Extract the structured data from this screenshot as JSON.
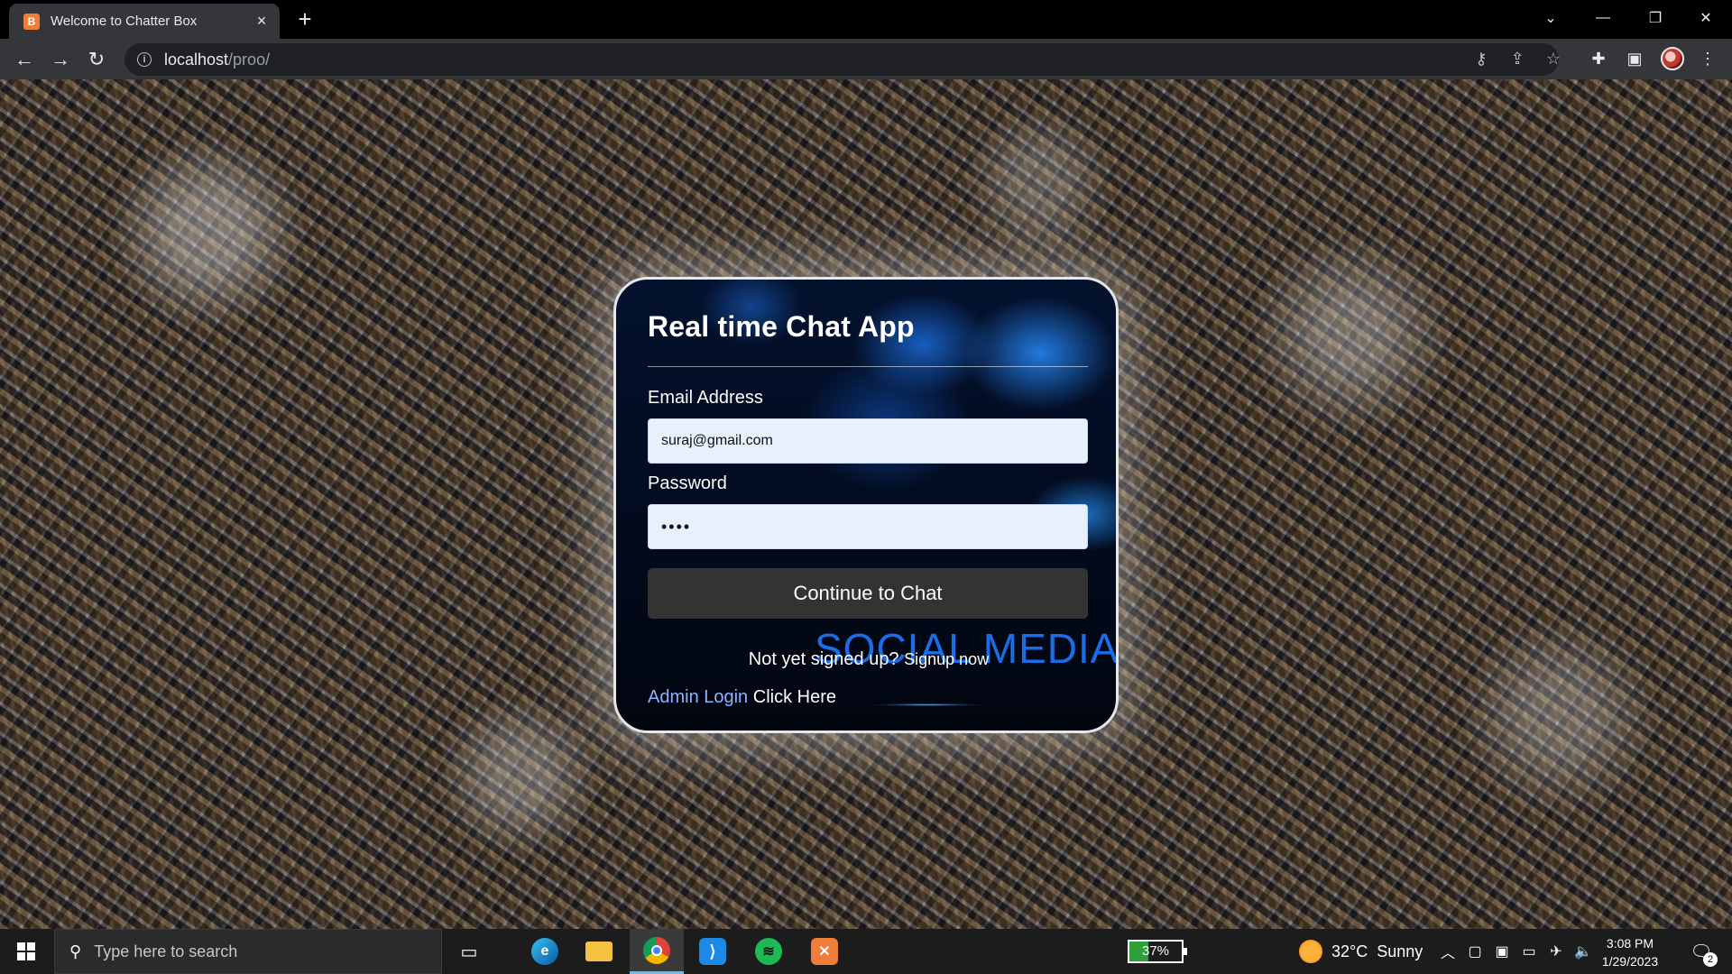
{
  "browser": {
    "tab_title": "Welcome to Chatter Box",
    "tab_favicon_letter": "B",
    "new_tab_symbol": "+",
    "url_host": "localhost",
    "url_path": "/proo/",
    "tab_close_symbol": "×"
  },
  "login": {
    "title": "Real time Chat App",
    "email_label": "Email Address",
    "email_value": "suraj@gmail.com",
    "password_label": "Password",
    "password_value": "••••",
    "submit_label": "Continue to Chat",
    "background_text": "SOCIAL MEDIA",
    "signup_prompt": "Not yet signed up?",
    "signup_link": "Signup now",
    "admin_link": "Admin Login",
    "admin_suffix": "Click Here"
  },
  "taskbar": {
    "search_placeholder": "Type here to search",
    "battery_percent": "37%",
    "battery_level": 0.37,
    "weather_temp": "32°C",
    "weather_desc": "Sunny",
    "time": "3:08 PM",
    "date": "1/29/2023",
    "notification_count": "2"
  },
  "colors": {
    "accent_link": "#8ab4ff",
    "button_bg": "#333333",
    "watermark": "#1f78ff",
    "battery_fill": "#2e9d3a"
  },
  "icons": [
    "tab-close-icon",
    "new-tab-icon",
    "back-icon",
    "forward-icon",
    "reload-icon",
    "site-info-icon",
    "key-icon",
    "share-icon",
    "star-icon",
    "extensions-icon",
    "side-panel-icon",
    "menu-icon",
    "windows-start-icon",
    "search-icon",
    "task-view-icon",
    "edge-icon",
    "file-explorer-icon",
    "chrome-icon",
    "vscode-icon",
    "spotify-icon",
    "xampp-icon",
    "sun-icon",
    "chevron-up-icon",
    "wifi-icon",
    "volume-icon",
    "notification-icon"
  ]
}
